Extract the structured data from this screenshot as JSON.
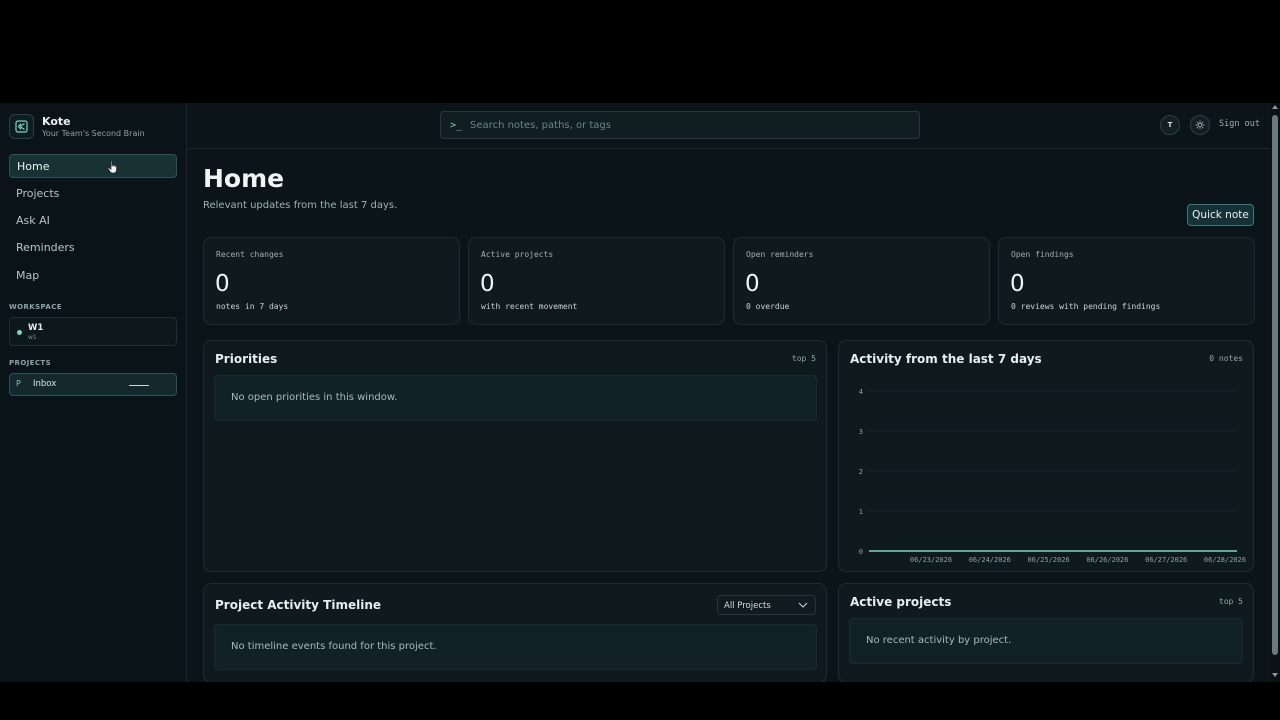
{
  "brand": {
    "name": "Kote",
    "tagline": "Your Team's Second Brain"
  },
  "nav": [
    {
      "label": "Home",
      "active": true
    },
    {
      "label": "Projects"
    },
    {
      "label": "Ask AI"
    },
    {
      "label": "Reminders"
    },
    {
      "label": "Map"
    }
  ],
  "workspace": {
    "section": "WORKSPACE",
    "name": "W1",
    "sub": "w1"
  },
  "projects": {
    "section": "PROJECTS",
    "icon_letter": "P",
    "name": "Inbox"
  },
  "search": {
    "prompt": ">_",
    "placeholder": "Search notes, paths, or tags"
  },
  "user": {
    "initial": "T",
    "signout": "Sign out"
  },
  "page": {
    "title": "Home",
    "subtitle": "Relevant updates from the last 7 days.",
    "quick_note": "Quick note"
  },
  "stats": [
    {
      "label": "Recent changes",
      "value": "0",
      "sub": "notes in 7 days"
    },
    {
      "label": "Active projects",
      "value": "0",
      "sub": "with recent movement"
    },
    {
      "label": "Open reminders",
      "value": "0",
      "sub": "0 overdue"
    },
    {
      "label": "Open findings",
      "value": "0",
      "sub": "0 reviews with pending findings"
    }
  ],
  "priorities": {
    "title": "Priorities",
    "tag": "top 5",
    "empty": "No open priorities in this window."
  },
  "activity": {
    "title": "Activity from the last 7 days",
    "tag": "0 notes"
  },
  "timeline": {
    "title": "Project Activity Timeline",
    "filter": "All Projects",
    "empty": "No timeline events found for this project."
  },
  "active_projects": {
    "title": "Active projects",
    "tag": "top 5",
    "empty": "No recent activity by project."
  },
  "chart_data": {
    "type": "line",
    "x": [
      "06/23/2026",
      "06/24/2026",
      "06/25/2026",
      "06/26/2026",
      "06/27/2026",
      "06/28/2026"
    ],
    "series": [
      {
        "values": [
          0,
          0,
          0,
          0,
          0,
          0
        ]
      }
    ],
    "yticks": [
      "0",
      "1",
      "2",
      "3",
      "4"
    ],
    "ylim": [
      0,
      4
    ],
    "grid": true,
    "color": "#7fd4c0"
  },
  "colors": {
    "accent": "#7fd4c0",
    "background": "#0b1519"
  }
}
